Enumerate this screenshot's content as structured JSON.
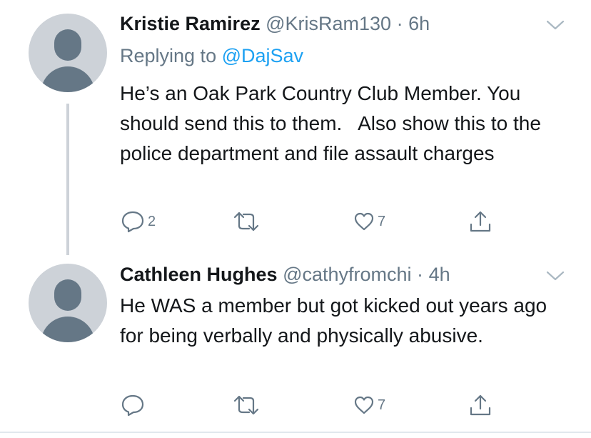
{
  "tweets": [
    {
      "name": "Kristie Ramirez",
      "handle": "@KrisRam130",
      "separator": "·",
      "time": "6h",
      "replying_label": "Replying to",
      "replying_to": "@DajSav",
      "text": "He’s an Oak Park Country Club Member. You should send this to them.   Also show this to the police department and file assault charges",
      "reply_count": "2",
      "retweet_count": "",
      "like_count": "7"
    },
    {
      "name": "Cathleen Hughes",
      "handle": "@cathyfromchi",
      "separator": "·",
      "time": "4h",
      "text": "He WAS a member but got kicked out years ago  for being verbally and physically abusive.",
      "reply_count": "",
      "retweet_count": "",
      "like_count": "7"
    }
  ],
  "icons": {
    "reply": "reply-icon",
    "retweet": "retweet-icon",
    "like": "heart-icon",
    "share": "share-icon",
    "menu": "chevron-down-icon"
  },
  "colors": {
    "text": "#14171a",
    "secondary": "#657786",
    "link": "#1da1f2",
    "avatar_bg": "#cdd2d8"
  }
}
